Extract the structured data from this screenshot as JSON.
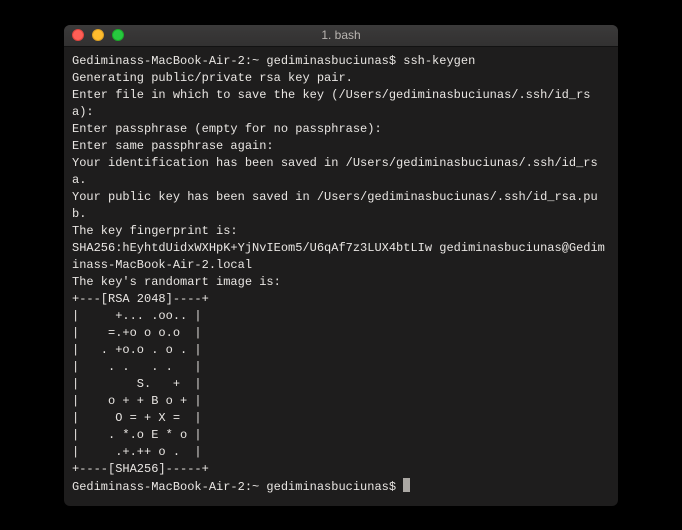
{
  "window": {
    "title": "1. bash"
  },
  "terminal": {
    "lines": [
      "Gediminass-MacBook-Air-2:~ gediminasbuciunas$ ssh-keygen",
      "Generating public/private rsa key pair.",
      "Enter file in which to save the key (/Users/gediminasbuciunas/.ssh/id_rsa):",
      "Enter passphrase (empty for no passphrase):",
      "Enter same passphrase again:",
      "Your identification has been saved in /Users/gediminasbuciunas/.ssh/id_rsa.",
      "Your public key has been saved in /Users/gediminasbuciunas/.ssh/id_rsa.pub.",
      "The key fingerprint is:",
      "SHA256:hEyhtdUidxWXHpK+YjNvIEom5/U6qAf7z3LUX4btLIw gediminasbuciunas@Gediminass-MacBook-Air-2.local",
      "The key's randomart image is:",
      "+---[RSA 2048]----+",
      "|     +... .oo.. |",
      "|    =.+o o o.o  |",
      "|   . +o.o . o . |",
      "|    . .   . .   |",
      "|        S.   +  |",
      "|    o + + B o + |",
      "|     O = + X =  |",
      "|    . *.o E * o |",
      "|     .+.++ o .  |",
      "+----[SHA256]-----+"
    ],
    "prompt": "Gediminass-MacBook-Air-2:~ gediminasbuciunas$ "
  }
}
